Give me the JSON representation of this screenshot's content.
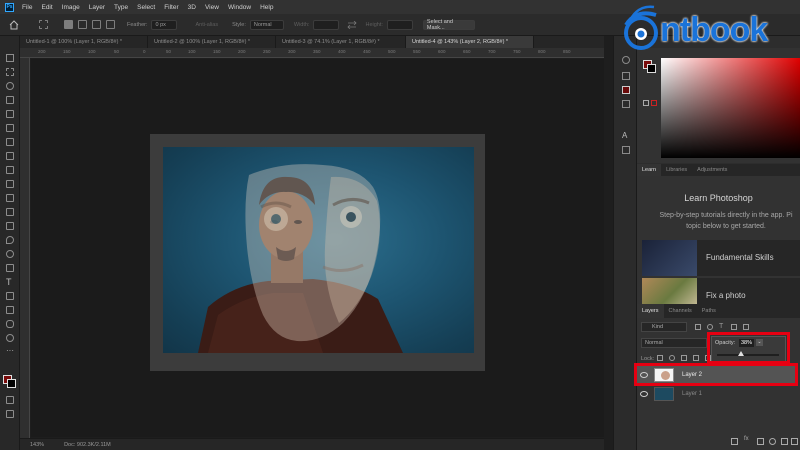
{
  "menubar": {
    "ps_logo": "Ps",
    "items": [
      "File",
      "Edit",
      "Image",
      "Layer",
      "Type",
      "Select",
      "Filter",
      "3D",
      "View",
      "Window",
      "Help"
    ]
  },
  "options": {
    "feather_label": "Feather:",
    "feather_value": "0 px",
    "anti_alias": "Anti-alias",
    "style_label": "Style:",
    "style_value": "Normal",
    "width_label": "Width:",
    "height_label": "Height:",
    "select_mask": "Select and Mask..."
  },
  "tabs": [
    "Untitled-1 @ 100% (Layer 1, RGB/8#) *",
    "Untitled-2 @ 100% (Layer 1, RGB/8#) *",
    "Untitled-3 @ 74.1% (Layer 1, RGB/8#) *",
    "Untitled-4 @ 143% (Layer 2, RGB/8#) *"
  ],
  "ruler_ticks": [
    "200",
    "150",
    "100",
    "50",
    "0",
    "50",
    "100",
    "150",
    "200",
    "250",
    "300",
    "350",
    "400",
    "450",
    "500",
    "550",
    "600",
    "650",
    "700",
    "750",
    "800",
    "850"
  ],
  "status": {
    "zoom": "143%",
    "doc": "Doc: 902.3K/2.11M"
  },
  "learn": {
    "tabs": [
      "Learn",
      "Libraries",
      "Adjustments"
    ],
    "title": "Learn Photoshop",
    "desc_line1": "Step-by-step tutorials directly in the app. Pi",
    "desc_line2": "topic below to get started.",
    "lessons": [
      "Fundamental Skills",
      "Fix a photo"
    ]
  },
  "layers": {
    "tabs": [
      "Layers",
      "Channels",
      "Paths"
    ],
    "kind": "Kind",
    "blend": "Normal",
    "lock": "Lock:",
    "opacity_label": "Opacity:",
    "opacity_value": "38%",
    "opacity_level": 0.38,
    "rows": [
      "Layer 2",
      "Layer 1"
    ]
  },
  "logo": {
    "text": "ntbook"
  },
  "colors": {
    "accent_red": "#e60012",
    "logo_blue": "#1a73d9",
    "foreground": "#7a0b0b"
  }
}
